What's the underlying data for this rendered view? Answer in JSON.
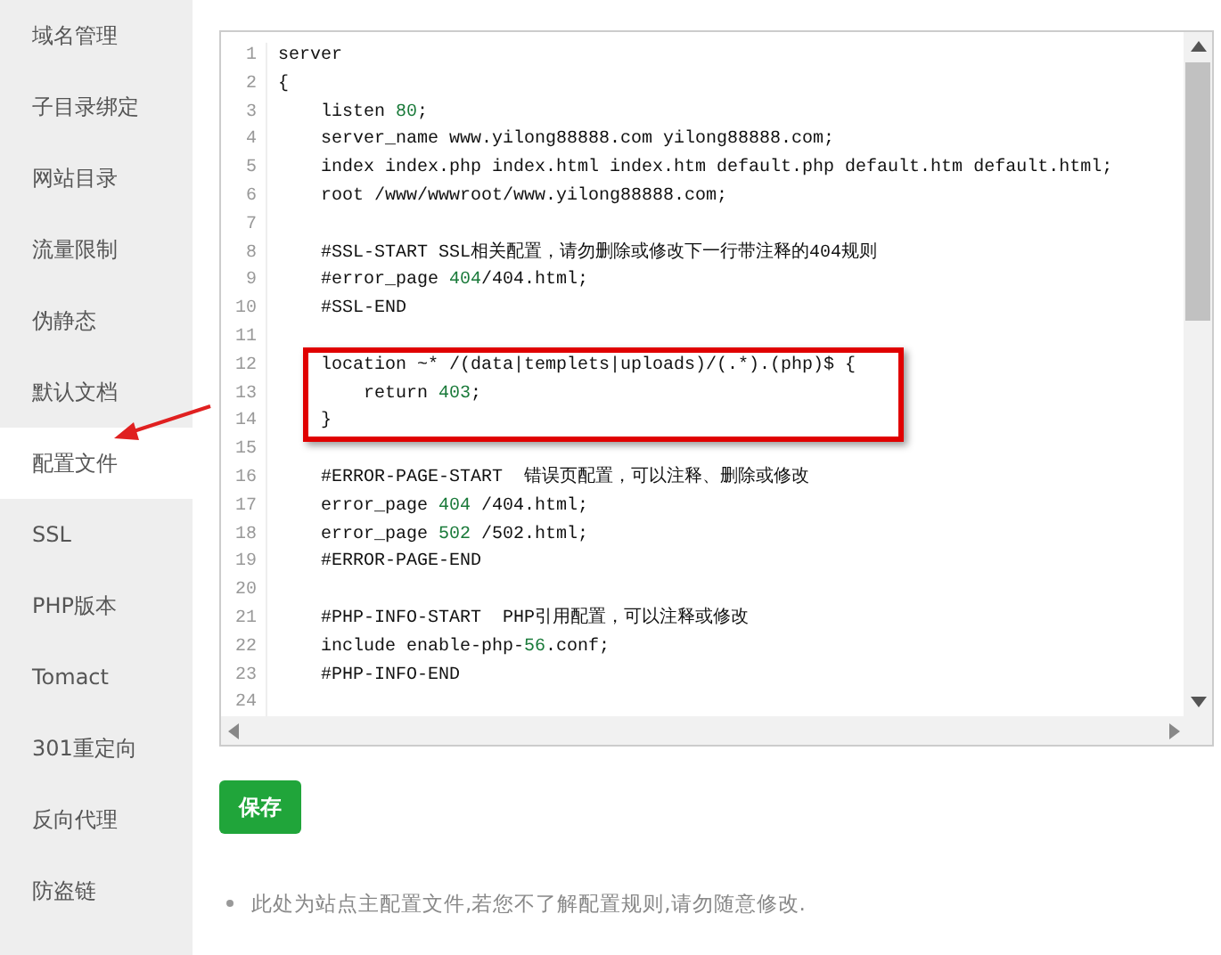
{
  "sidebar": {
    "items": [
      {
        "label": "域名管理",
        "selected": false
      },
      {
        "label": "子目录绑定",
        "selected": false
      },
      {
        "label": "网站目录",
        "selected": false
      },
      {
        "label": "流量限制",
        "selected": false
      },
      {
        "label": "伪静态",
        "selected": false
      },
      {
        "label": "默认文档",
        "selected": false
      },
      {
        "label": "配置文件",
        "selected": true
      },
      {
        "label": "SSL",
        "selected": false
      },
      {
        "label": "PHP版本",
        "selected": false
      },
      {
        "label": "Tomact",
        "selected": false
      },
      {
        "label": "301重定向",
        "selected": false
      },
      {
        "label": "反向代理",
        "selected": false
      },
      {
        "label": "防盗链",
        "selected": false
      }
    ]
  },
  "editor": {
    "lines": [
      {
        "number": "1",
        "highlighted": false,
        "segments": [
          {
            "text": "server",
            "kind": "plain"
          }
        ]
      },
      {
        "number": "2",
        "highlighted": false,
        "segments": [
          {
            "text": "{",
            "kind": "plain"
          }
        ]
      },
      {
        "number": "3",
        "highlighted": false,
        "segments": [
          {
            "text": "    listen ",
            "kind": "plain"
          },
          {
            "text": "80",
            "kind": "number"
          },
          {
            "text": ";",
            "kind": "plain"
          }
        ]
      },
      {
        "number": "4",
        "highlighted": false,
        "segments": [
          {
            "text": "    server_name www.yilong88888.com yilong88888.com;",
            "kind": "plain"
          }
        ]
      },
      {
        "number": "5",
        "highlighted": false,
        "segments": [
          {
            "text": "    index index.php index.html index.htm default.php default.htm default.html;",
            "kind": "plain"
          }
        ]
      },
      {
        "number": "6",
        "highlighted": false,
        "segments": [
          {
            "text": "    root /www/wwwroot/www.yilong88888.com;",
            "kind": "plain"
          }
        ]
      },
      {
        "number": "7",
        "highlighted": false
      },
      {
        "number": "8",
        "highlighted": false,
        "segments": [
          {
            "text": "    #SSL-START SSL相关配置，请勿删除或修改下一行带注释的404规则",
            "kind": "plain"
          }
        ]
      },
      {
        "number": "9",
        "highlighted": false,
        "segments": [
          {
            "text": "    #error_page ",
            "kind": "plain"
          },
          {
            "text": "404",
            "kind": "number"
          },
          {
            "text": "/404.html;",
            "kind": "plain"
          }
        ]
      },
      {
        "number": "10",
        "highlighted": false,
        "segments": [
          {
            "text": "    #SSL-END",
            "kind": "plain"
          }
        ]
      },
      {
        "number": "11",
        "highlighted": false
      },
      {
        "number": "12",
        "highlighted": true,
        "segments": [
          {
            "text": "    location ~* /(data|templets|uploads)/(.*).(php)$ {",
            "kind": "plain"
          }
        ]
      },
      {
        "number": "13",
        "highlighted": true,
        "segments": [
          {
            "text": "        return ",
            "kind": "plain"
          },
          {
            "text": "403",
            "kind": "number"
          },
          {
            "text": ";",
            "kind": "plain"
          }
        ]
      },
      {
        "number": "14",
        "highlighted": true,
        "segments": [
          {
            "text": "    }",
            "kind": "plain"
          }
        ]
      },
      {
        "number": "15",
        "highlighted": false
      },
      {
        "number": "16",
        "highlighted": false,
        "segments": [
          {
            "text": "    #ERROR-PAGE-START  错误页配置，可以注释、删除或修改",
            "kind": "plain"
          }
        ]
      },
      {
        "number": "17",
        "highlighted": false,
        "segments": [
          {
            "text": "    error_page ",
            "kind": "plain"
          },
          {
            "text": "404",
            "kind": "number"
          },
          {
            "text": " /404.html;",
            "kind": "plain"
          }
        ]
      },
      {
        "number": "18",
        "highlighted": false,
        "segments": [
          {
            "text": "    error_page ",
            "kind": "plain"
          },
          {
            "text": "502",
            "kind": "number"
          },
          {
            "text": " /502.html;",
            "kind": "plain"
          }
        ]
      },
      {
        "number": "19",
        "highlighted": false,
        "segments": [
          {
            "text": "    #ERROR-PAGE-END",
            "kind": "plain"
          }
        ]
      },
      {
        "number": "20",
        "highlighted": false
      },
      {
        "number": "21",
        "highlighted": false,
        "segments": [
          {
            "text": "    #PHP-INFO-START  PHP引用配置，可以注释或修改",
            "kind": "plain"
          }
        ]
      },
      {
        "number": "22",
        "highlighted": false,
        "segments": [
          {
            "text": "    include enable-php-",
            "kind": "plain"
          },
          {
            "text": "56",
            "kind": "number"
          },
          {
            "text": ".conf;",
            "kind": "plain"
          }
        ]
      },
      {
        "number": "23",
        "highlighted": false,
        "segments": [
          {
            "text": "    #PHP-INFO-END",
            "kind": "plain"
          }
        ]
      },
      {
        "number": "24",
        "highlighted": false
      }
    ]
  },
  "save_button": {
    "label": "保存"
  },
  "notes": [
    "此处为站点主配置文件,若您不了解配置规则,请勿随意修改."
  ]
}
